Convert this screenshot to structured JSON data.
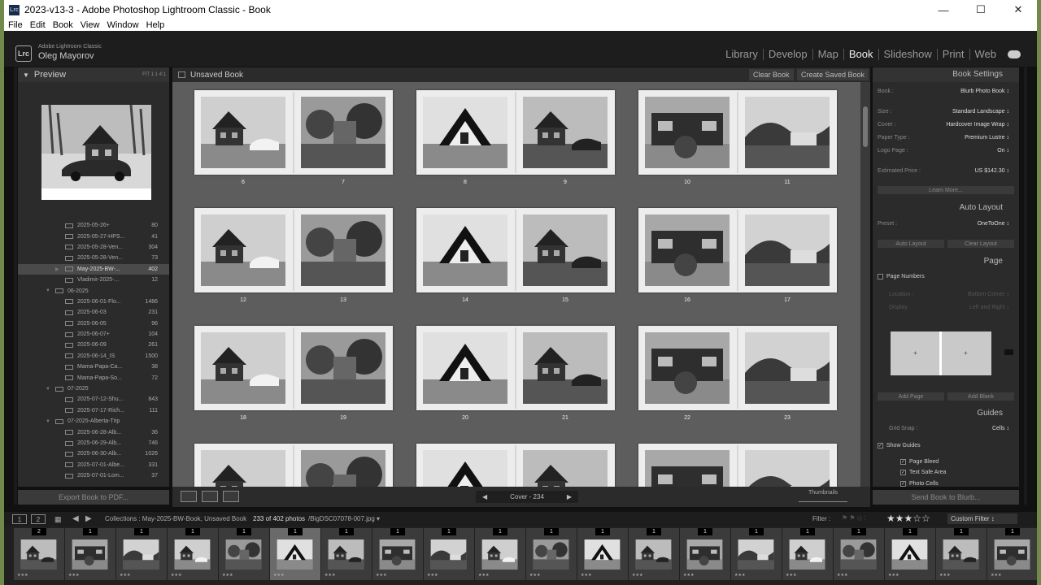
{
  "window": {
    "title": "2023-v13-3 - Adobe Photoshop Lightroom Classic - Book",
    "app_icon": "Lrc",
    "controls": [
      "—",
      "☐",
      "✕"
    ]
  },
  "menu": [
    "File",
    "Edit",
    "Book",
    "View",
    "Window",
    "Help"
  ],
  "brand": {
    "logo": "Lrc",
    "product": "Adobe Lightroom Classic",
    "user": "Oleg Mayorov"
  },
  "modules": [
    "Library",
    "Develop",
    "Map",
    "Book",
    "Slideshow",
    "Print",
    "Web"
  ],
  "active_module": "Book",
  "left": {
    "preview_label": "Preview",
    "preview_controls": "FIT  1:1  4:1",
    "tree": [
      {
        "label": "2025-05-26+",
        "count": "80",
        "indent": 1
      },
      {
        "label": "2025-05-27-HPS...",
        "count": "41",
        "indent": 1
      },
      {
        "label": "2025-05-28-Ven...",
        "count": "304",
        "indent": 1
      },
      {
        "label": "2025-05-28-Ven...",
        "count": "73",
        "indent": 1
      },
      {
        "label": "May-2025-BW-...",
        "count": "402",
        "indent": 1,
        "selected": true
      },
      {
        "label": "Vladimir-2025-...",
        "count": "12",
        "indent": 1
      },
      {
        "label": "06-2025",
        "count": "",
        "indent": 0
      },
      {
        "label": "2025-06-01-Flo...",
        "count": "1486",
        "indent": 1
      },
      {
        "label": "2025-06-03",
        "count": "231",
        "indent": 1
      },
      {
        "label": "2025-06-05",
        "count": "96",
        "indent": 1
      },
      {
        "label": "2025-06-07+",
        "count": "104",
        "indent": 1
      },
      {
        "label": "2025-06-09",
        "count": "261",
        "indent": 1
      },
      {
        "label": "2025-06-14_IS",
        "count": "1500",
        "indent": 1
      },
      {
        "label": "Mama-Papa-Ca...",
        "count": "38",
        "indent": 1
      },
      {
        "label": "Mama-Papa-So...",
        "count": "72",
        "indent": 1
      },
      {
        "label": "07-2025",
        "count": "",
        "indent": 0
      },
      {
        "label": "2025-07-12-Shu...",
        "count": "843",
        "indent": 1
      },
      {
        "label": "2025-07-17-Rich...",
        "count": "111",
        "indent": 1
      },
      {
        "label": "07-2025-Alberta-Trip",
        "count": "",
        "indent": 0
      },
      {
        "label": "2025-06-28-Alb...",
        "count": "36",
        "indent": 1
      },
      {
        "label": "2025-06-29-Alb...",
        "count": "746",
        "indent": 1
      },
      {
        "label": "2025-06-30-Alb...",
        "count": "1026",
        "indent": 1
      },
      {
        "label": "2025-07-01-Albe...",
        "count": "331",
        "indent": 1
      },
      {
        "label": "2025-07-01-Lom...",
        "count": "37",
        "indent": 1
      }
    ],
    "export_button": "Export Book to PDF..."
  },
  "center": {
    "book_name": "Unsaved Book",
    "clear_button": "Clear Book",
    "save_button": "Create Saved Book",
    "spreads": [
      {
        "left": "6",
        "right": "7"
      },
      {
        "left": "8",
        "right": "9"
      },
      {
        "left": "10",
        "right": "11"
      },
      {
        "left": "12",
        "right": "13"
      },
      {
        "left": "14",
        "right": "15"
      },
      {
        "left": "16",
        "right": "17"
      },
      {
        "left": "18",
        "right": "19"
      },
      {
        "left": "20",
        "right": "21"
      },
      {
        "left": "22",
        "right": "23"
      },
      {
        "left": "",
        "right": ""
      },
      {
        "left": "",
        "right": ""
      },
      {
        "left": "",
        "right": ""
      }
    ],
    "pager": {
      "prev": "◀",
      "label": "Cover - 234",
      "next": "▶"
    },
    "thumbnails_label": "Thumbnails"
  },
  "right": {
    "book_settings": "Book Settings",
    "book_label": "Book :",
    "book_value": "Blurb Photo Book ↕",
    "size_label": "Size :",
    "size_value": "Standard Landscape ↕",
    "cover_label": "Cover :",
    "cover_value": "Hardcover Image Wrap ↕",
    "paper_label": "Paper Type :",
    "paper_value": "Premium Lustre ↕",
    "logo_label": "Logo Page :",
    "logo_value": "On ↕",
    "price_label": "Estimated Price :",
    "price_value": "US $142.30 ↕",
    "learn_more": "Learn More...",
    "auto_layout": "Auto Layout",
    "preset_label": "Preset :",
    "preset_value": "OneToOne ↕",
    "auto_layout_btn": "Auto Layout",
    "clear_layout_btn": "Clear Layout",
    "page": "Page",
    "page_numbers": "Page Numbers",
    "location_label": "Location :",
    "location_value": "Bottom Corner ↕",
    "display_label": "Display :",
    "display_value": "Left and Right ↕",
    "add_page": "Add Page",
    "add_blank": "Add Blank",
    "guides": "Guides",
    "grid_snap_label": "Grid Snap :",
    "grid_snap_value": "Cells ↕",
    "show_guides": "Show Guides",
    "page_bleed": "Page Bleed",
    "text_safe": "Text Safe Area",
    "photo_cells": "Photo Cells",
    "send_button": "Send Book to Blurb..."
  },
  "filmbar": {
    "page1": "1",
    "page2": "2",
    "source": "Collections : May-2025-BW-Book, Unsaved Book",
    "count": "233 of 402 photos",
    "file": "/BigDSC07078-007.jpg ▾",
    "filter_label": "Filter :",
    "stars": "★★★☆☆",
    "custom_filter": "Custom Filter ↕"
  },
  "film_badges": [
    "2",
    "1",
    "1",
    "1",
    "1",
    "1",
    "1",
    "1",
    "1",
    "1",
    "1",
    "1",
    "1",
    "1",
    "1",
    "1",
    "1",
    "1",
    "1",
    "1"
  ],
  "film_stars": "★★★"
}
